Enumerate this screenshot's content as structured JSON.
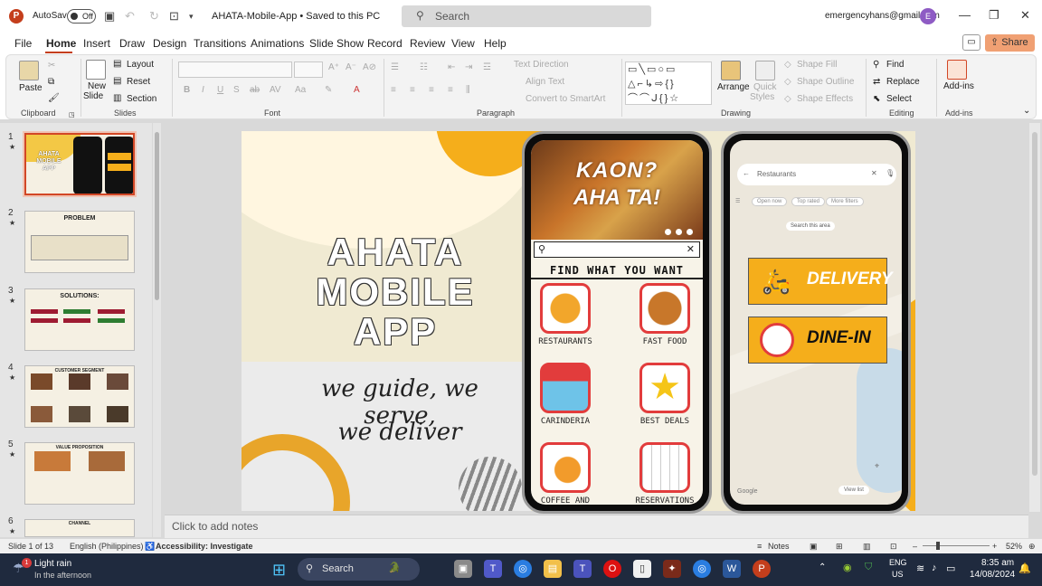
{
  "app": {
    "autosave_label": "AutoSave",
    "autosave_state": "Off",
    "doc_title": "AHATA-Mobile-App  •  Saved to this PC",
    "search_placeholder": "Search",
    "user_email": "emergencyhans@gmail.com",
    "user_initial": "E",
    "logo": "P"
  },
  "menu": {
    "tabs": [
      "File",
      "Home",
      "Insert",
      "Draw",
      "Design",
      "Transitions",
      "Animations",
      "Slide Show",
      "Record",
      "Review",
      "View",
      "Help"
    ],
    "active": "Home",
    "share_label": "Share"
  },
  "ribbon": {
    "clipboard": {
      "label": "Clipboard",
      "paste": "Paste"
    },
    "slides": {
      "label": "Slides",
      "new_slide": "New",
      "new_slide2": "Slide",
      "layout": "Layout",
      "reset": "Reset",
      "section": "Section"
    },
    "font": {
      "label": "Font"
    },
    "paragraph": {
      "label": "Paragraph",
      "text_direction": "Text Direction",
      "align_text": "Align Text",
      "convert": "Convert to SmartArt"
    },
    "drawing": {
      "label": "Drawing",
      "arrange": "Arrange",
      "quick_styles": "Quick",
      "quick_styles2": "Styles",
      "shape_fill": "Shape Fill",
      "shape_outline": "Shape Outline",
      "shape_effects": "Shape Effects"
    },
    "editing": {
      "label": "Editing",
      "find": "Find",
      "replace": "Replace",
      "select": "Select"
    },
    "addins": {
      "label": "Add-ins",
      "addins": "Add-ins"
    }
  },
  "thumbnails": [
    {
      "num": "1",
      "title": ""
    },
    {
      "num": "2",
      "title": "PROBLEM"
    },
    {
      "num": "3",
      "title": "SOLUTIONS:"
    },
    {
      "num": "4",
      "title": "CUSTOMER SEGMENT"
    },
    {
      "num": "5",
      "title": "VALUE PROPOSITION"
    },
    {
      "num": "6",
      "title": "CHANNEL"
    }
  ],
  "slide": {
    "title_l1": "AHATA",
    "title_l2": "MOBILE",
    "title_l3": "APP",
    "tagline_l1": "we guide, we serve,",
    "tagline_l2": "we deliver",
    "phone1": {
      "banner_l1": "KAON?",
      "banner_l2": "AHA TA!",
      "heading": "FIND WHAT YOU WANT",
      "items": [
        "RESTAURANTS",
        "FAST FOOD",
        "CARINDERIA",
        "BEST DEALS",
        "COFFEE AND TEA",
        "RESERVATIONS"
      ]
    },
    "phone2": {
      "search_text": "Restaurants",
      "chips": [
        "Open now",
        "Top rated",
        "More filters"
      ],
      "search_area": "Search this area",
      "view_list": "View list",
      "google": "Google",
      "delivery": "DELIVERY",
      "dine_in": "DINE-IN"
    }
  },
  "notes_placeholder": "Click to add notes",
  "status": {
    "slide_of": "Slide 1 of 13",
    "language": "English (Philippines)",
    "accessibility": "Accessibility: Investigate",
    "notes": "Notes",
    "zoom": "52%"
  },
  "taskbar": {
    "weather_title": "Light rain",
    "weather_sub": "In the afternoon",
    "weather_badge": "1",
    "search": "Search",
    "lang_l1": "ENG",
    "lang_l2": "US",
    "time": "8:35 am",
    "date": "14/08/2024"
  }
}
